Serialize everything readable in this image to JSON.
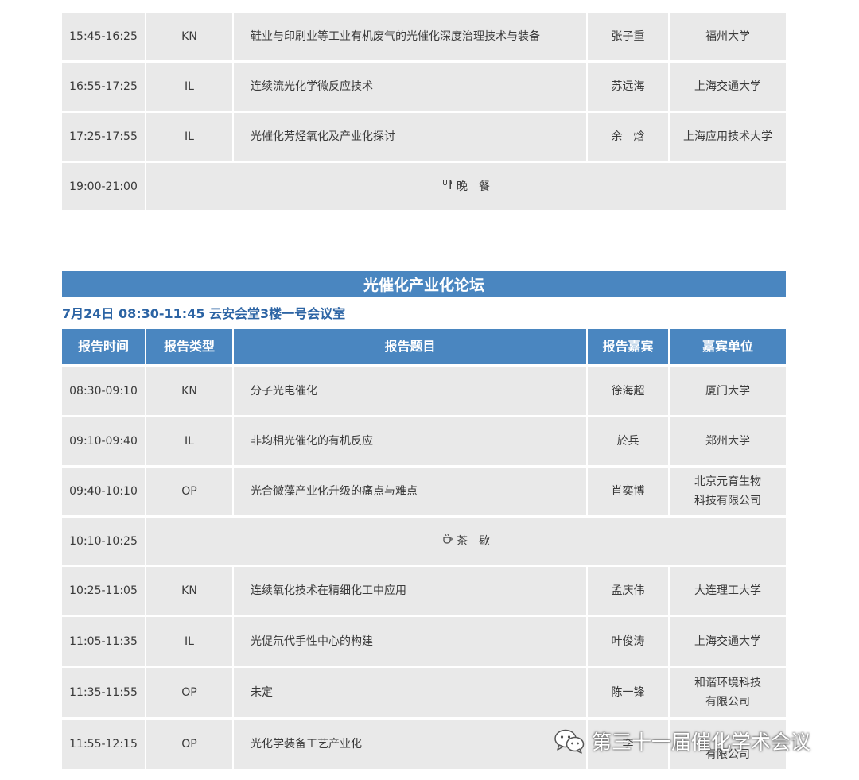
{
  "session1": {
    "rows": [
      {
        "time": "15:45-16:25",
        "type": "KN",
        "title": "鞋业与印刷业等工业有机废气的光催化深度治理技术与装备",
        "speaker": "张子重",
        "affiliation": "福州大学"
      },
      {
        "time": "16:55-17:25",
        "type": "IL",
        "title": "连续流光化学微反应技术",
        "speaker": "苏远海",
        "affiliation": "上海交通大学"
      },
      {
        "time": "17:25-17:55",
        "type": "IL",
        "title": "光催化芳烃氧化及产业化探讨",
        "speaker": "余　焓",
        "affiliation": "上海应用技术大学"
      }
    ],
    "dinner": {
      "time": "19:00-21:00",
      "label": "晚　餐",
      "icon": "fork-knife-icon"
    }
  },
  "session2": {
    "banner": "光催化产业化论坛",
    "subtitle": "7月24日  08:30-11:45  云安会堂3楼一号会议室",
    "headers": {
      "time": "报告时间",
      "type": "报告类型",
      "title": "报告题目",
      "speaker": "报告嘉宾",
      "affiliation": "嘉宾单位"
    },
    "rows_a": [
      {
        "time": "08:30-09:10",
        "type": "KN",
        "title": "分子光电催化",
        "speaker": "徐海超",
        "affiliation": "厦门大学"
      },
      {
        "time": "09:10-09:40",
        "type": "IL",
        "title": "非均相光催化的有机反应",
        "speaker": "於兵",
        "affiliation": "郑州大学"
      },
      {
        "time": "09:40-10:10",
        "type": "OP",
        "title": "光合微藻产业化升级的痛点与难点",
        "speaker": "肖奕博",
        "affiliation": "北京元育生物\n科技有限公司"
      }
    ],
    "tea": {
      "time": "10:10-10:25",
      "label": "茶　歇",
      "icon": "tea-cup-icon"
    },
    "rows_b": [
      {
        "time": "10:25-11:05",
        "type": "KN",
        "title": "连续氧化技术在精细化工中应用",
        "speaker": "孟庆伟",
        "affiliation": "大连理工大学"
      },
      {
        "time": "11:05-11:35",
        "type": "IL",
        "title": "光促氘代手性中心的构建",
        "speaker": "叶俊涛",
        "affiliation": "上海交通大学"
      },
      {
        "time": "11:35-11:55",
        "type": "OP",
        "title": "未定",
        "speaker": "陈一锋",
        "affiliation": "和谐环境科技\n有限公司"
      },
      {
        "time": "11:55-12:15",
        "type": "OP",
        "title": "光化学装备工艺产业化",
        "speaker": "李",
        "affiliation": "有限公司"
      }
    ]
  },
  "watermark": {
    "text": "第三十一届催化学术会议",
    "icon": "wechat-icon"
  }
}
